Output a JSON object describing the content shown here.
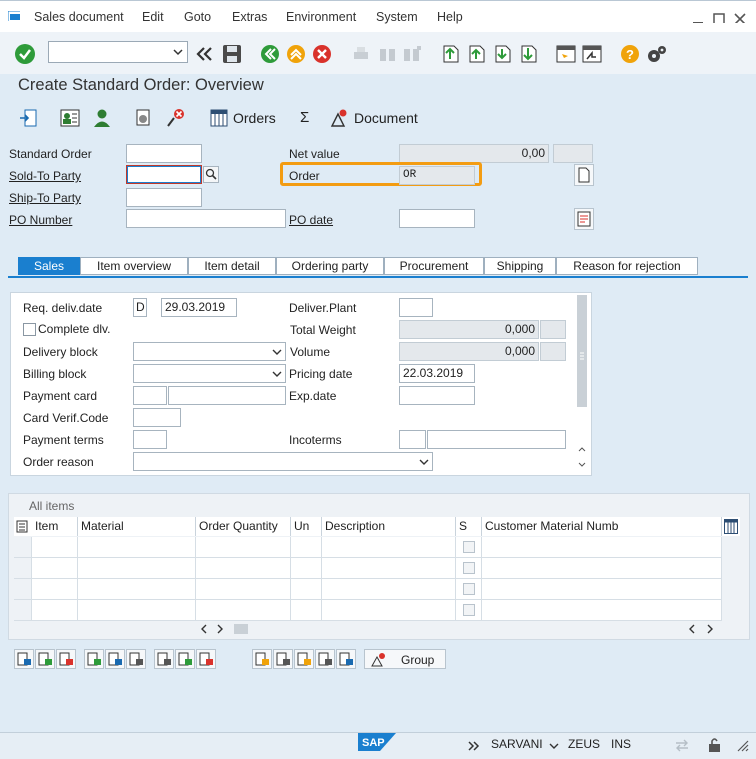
{
  "menu": {
    "items": [
      "Sales document",
      "Edit",
      "Goto",
      "Extras",
      "Environment",
      "System",
      "Help"
    ]
  },
  "toolbar": {
    "command_value": ""
  },
  "title": "Create Standard Order: Overview",
  "app_toolbar": {
    "orders_label": "Orders",
    "sum_label": "Σ",
    "document_label": "Document"
  },
  "header": {
    "standard_order_label": "Standard Order",
    "standard_order_value": "",
    "sold_to_label": "Sold-To Party",
    "sold_to_value": "",
    "ship_to_label": "Ship-To Party",
    "ship_to_value": "",
    "po_number_label": "PO Number",
    "po_number_value": "",
    "net_value_label": "Net value",
    "net_value": "0,00",
    "order_label": "Order",
    "order_value": "OR",
    "po_date_label": "PO date",
    "po_date_value": ""
  },
  "tabs": [
    "Sales",
    "Item overview",
    "Item detail",
    "Ordering party",
    "Procurement",
    "Shipping",
    "Reason for rejection"
  ],
  "sales": {
    "req_deliv_label": "Req. deliv.date",
    "req_deliv_format": "D",
    "req_deliv_date": "29.03.2019",
    "complete_dlv_label": "Complete dlv.",
    "delivery_block_label": "Delivery block",
    "billing_block_label": "Billing block",
    "payment_card_label": "Payment card",
    "card_verif_label": "Card Verif.Code",
    "payment_terms_label": "Payment terms",
    "order_reason_label": "Order reason",
    "deliver_plant_label": "Deliver.Plant",
    "total_weight_label": "Total Weight",
    "total_weight": "0,000",
    "volume_label": "Volume",
    "volume": "0,000",
    "pricing_date_label": "Pricing date",
    "pricing_date": "22.03.2019",
    "exp_date_label": "Exp.date",
    "incoterms_label": "Incoterms"
  },
  "items": {
    "title": "All items",
    "columns": [
      "Item",
      "Material",
      "Order Quantity",
      "Un",
      "Description",
      "S",
      "Customer Material Numb"
    ],
    "row_count": 4,
    "group_label": "Group"
  },
  "status": {
    "user": "SARVANI",
    "server": "ZEUS",
    "mode": "INS",
    "logo": "SAP"
  },
  "colors": {
    "accent": "#1a7fcf",
    "highlight": "#f39c12",
    "ok": "#2e9b3a",
    "cancel": "#d9322b"
  }
}
